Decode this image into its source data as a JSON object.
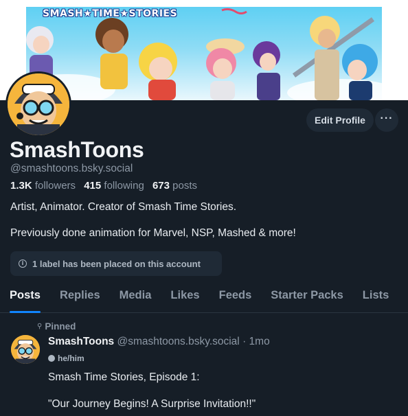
{
  "banner": {
    "logo_text": "SMASH★TIME★STORIES"
  },
  "profile": {
    "display_name": "SmashToons",
    "handle": "@smashtoons.bsky.social",
    "stats": {
      "followers_count": "1.3K",
      "followers_label": "followers",
      "following_count": "415",
      "following_label": "following",
      "posts_count": "673",
      "posts_label": "posts"
    },
    "bio": [
      "Artist, Animator. Creator of Smash Time Stories.",
      "Previously done animation for Marvel, NSP, Mashed & more!"
    ],
    "label_notice": "1 label has been placed on this account"
  },
  "actions": {
    "edit_profile": "Edit Profile",
    "more": "···"
  },
  "tabs": [
    {
      "label": "Posts",
      "active": true
    },
    {
      "label": "Replies",
      "active": false
    },
    {
      "label": "Media",
      "active": false
    },
    {
      "label": "Likes",
      "active": false
    },
    {
      "label": "Feeds",
      "active": false
    },
    {
      "label": "Starter Packs",
      "active": false
    },
    {
      "label": "Lists",
      "active": false
    }
  ],
  "post": {
    "pinned_label": "Pinned",
    "author_name": "SmashToons",
    "author_handle": "@smashtoons.bsky.social",
    "separator": "·",
    "age": "1mo",
    "pronouns": "he/him",
    "text": [
      "Smash Time Stories, Episode 1:",
      "\"Our Journey Begins! A Surprise Invitation!!\""
    ]
  },
  "colors": {
    "background": "#161e27",
    "accent": "#1185fe",
    "muted_text": "#8d98a5"
  }
}
